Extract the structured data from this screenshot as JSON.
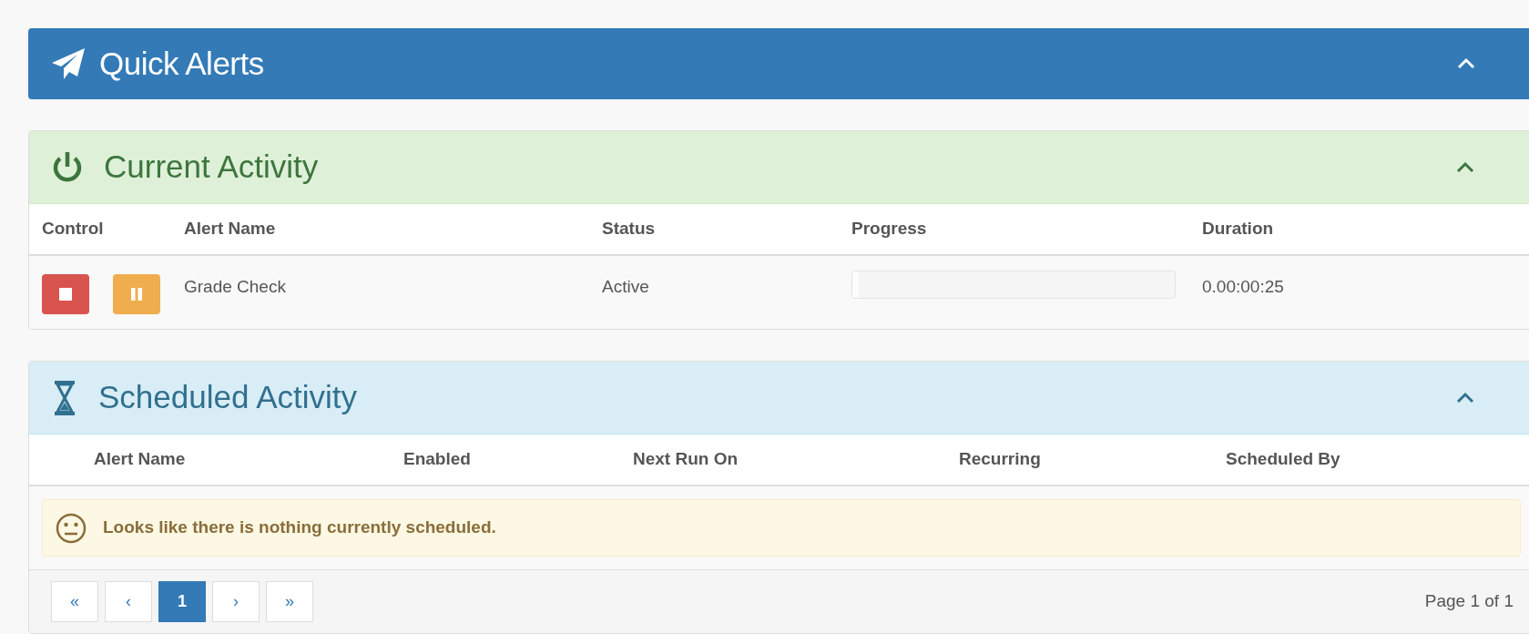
{
  "header": {
    "title": "Quick Alerts",
    "expanded": true
  },
  "current_activity": {
    "title": "Current Activity",
    "expanded": true,
    "columns": [
      "Control",
      "Alert Name",
      "Status",
      "Progress",
      "Duration"
    ],
    "rows": [
      {
        "alert_name": "Grade Check",
        "status": "Active",
        "level": 0.02,
        "duration": "0.00:00:25"
      }
    ]
  },
  "scheduled_activity": {
    "title": "Scheduled Activity",
    "expanded": true,
    "columns": [
      "Alert Name",
      "Enabled",
      "Next Run On",
      "Recurring",
      "Scheduled By"
    ],
    "empty_message": "Looks like there is nothing currently scheduled.",
    "pagination": [
      {
        "label": "«",
        "selected": false
      },
      {
        "label": "‹",
        "selected": false
      },
      {
        "label": "1",
        "selected": true
      },
      {
        "label": "›",
        "selected": false
      },
      {
        "label": "»",
        "selected": false
      }
    ],
    "page_info": "Page 1 of 1"
  }
}
